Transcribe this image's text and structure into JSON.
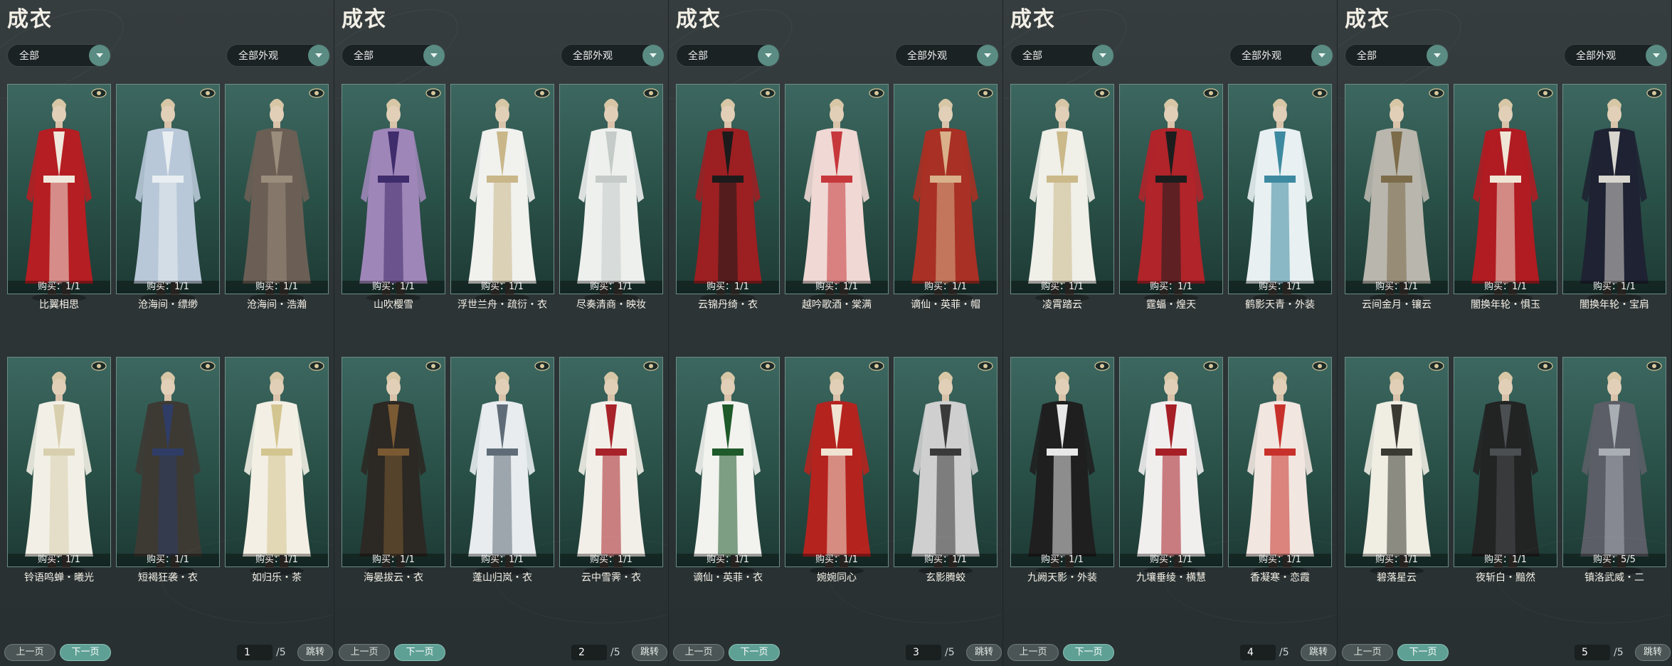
{
  "panels": [
    {
      "title": "成衣",
      "filter_category": "全部",
      "filter_appearance": "全部外观",
      "items": [
        {
          "name": "比翼相思",
          "buy": "购买：1/1",
          "color": "#b51e22",
          "accent": "#f0e8dc"
        },
        {
          "name": "沧海间・缥缈",
          "buy": "购买：1/1",
          "color": "#b8c8d8",
          "accent": "#e9eef2"
        },
        {
          "name": "沧海间・浩瀚",
          "buy": "购买：1/1",
          "color": "#6b5f55",
          "accent": "#9a8d7c"
        },
        {
          "name": "铃语鸣蝉・曦光",
          "buy": "购买：1/1",
          "color": "#f2f0e6",
          "accent": "#d8cfae"
        },
        {
          "name": "短褐狂袭・衣",
          "buy": "购买：1/1",
          "color": "#3d3a34",
          "accent": "#2f3d66"
        },
        {
          "name": "如归乐・茶",
          "buy": "购买：1/1",
          "color": "#f3efe4",
          "accent": "#d3c58f"
        }
      ],
      "prev_label": "上一页",
      "next_label": "下一页",
      "page": "1",
      "total": "/5",
      "jump_label": "跳转"
    },
    {
      "title": "成衣",
      "filter_category": "全部",
      "filter_appearance": "全部外观",
      "items": [
        {
          "name": "山吹樱雪",
          "buy": "购买：1/1",
          "color": "#9f86b8",
          "accent": "#3f2c6c"
        },
        {
          "name": "浮世兰舟・疏衍・衣",
          "buy": "购买：1/1",
          "color": "#f1f1ee",
          "accent": "#c9b78a"
        },
        {
          "name": "尽奏清商・映妆",
          "buy": "购买：1/1",
          "color": "#eef0ee",
          "accent": "#c4cbc8"
        },
        {
          "name": "海晏拔云・衣",
          "buy": "购买：1/1",
          "color": "#2c2823",
          "accent": "#7a5a33"
        },
        {
          "name": "蓬山归岚・衣",
          "buy": "购买：1/1",
          "color": "#e8ecee",
          "accent": "#5f6c78"
        },
        {
          "name": "云中雪霁・衣",
          "buy": "购买：1/1",
          "color": "#f2efe8",
          "accent": "#a8222a"
        }
      ],
      "prev_label": "上一页",
      "next_label": "下一页",
      "page": "2",
      "total": "/5",
      "jump_label": "跳转"
    },
    {
      "title": "成衣",
      "filter_category": "全部",
      "filter_appearance": "全部外观",
      "items": [
        {
          "name": "云锦丹绮・衣",
          "buy": "购买：1/1",
          "color": "#9c1f22",
          "accent": "#1c1a1a"
        },
        {
          "name": "越吟歌酒・棠满",
          "buy": "购买：1/1",
          "color": "#f0d8d4",
          "accent": "#c6383c"
        },
        {
          "name": "谪仙・英菲・帽",
          "buy": "购买：1/1",
          "color": "#a83024",
          "accent": "#d9b08a"
        },
        {
          "name": "谪仙・英菲・衣",
          "buy": "购买：1/1",
          "color": "#f2f2ee",
          "accent": "#1e5a2a"
        },
        {
          "name": "婉婉同心",
          "buy": "购买：1/1",
          "color": "#b5231f",
          "accent": "#f0e3d2"
        },
        {
          "name": "玄影腾蛟",
          "buy": "购买：1/1",
          "color": "#cfcfcf",
          "accent": "#3a3a3a"
        }
      ],
      "prev_label": "上一页",
      "next_label": "下一页",
      "page": "3",
      "total": "/5",
      "jump_label": "跳转"
    },
    {
      "title": "成衣",
      "filter_category": "全部",
      "filter_appearance": "全部外观",
      "items": [
        {
          "name": "凌霄踏云",
          "buy": "购买：1/1",
          "color": "#f0efe8",
          "accent": "#cbb98a"
        },
        {
          "name": "霆蝠・煌天",
          "buy": "购买：1/1",
          "color": "#b0242a",
          "accent": "#1d1d1d"
        },
        {
          "name": "鹤影天青・外装",
          "buy": "购买：1/1",
          "color": "#e8f0f2",
          "accent": "#3d8aa0"
        },
        {
          "name": "九阙天影・外装",
          "buy": "购买：1/1",
          "color": "#1f1f1f",
          "accent": "#e8e8e8"
        },
        {
          "name": "九壤垂绫・横慧",
          "buy": "购买：1/1",
          "color": "#f1eeee",
          "accent": "#a61f26"
        },
        {
          "name": "香凝寒・恋霞",
          "buy": "购买：1/1",
          "color": "#f2e6e0",
          "accent": "#c8312b"
        }
      ],
      "prev_label": "上一页",
      "next_label": "下一页",
      "page": "4",
      "total": "/5",
      "jump_label": "跳转"
    },
    {
      "title": "成衣",
      "filter_category": "全部",
      "filter_appearance": "全部外观",
      "items": [
        {
          "name": "云间金月・镶云",
          "buy": "购买：1/1",
          "color": "#b9b6ad",
          "accent": "#7c6c4a"
        },
        {
          "name": "闇换年轮・惧玉",
          "buy": "购买：1/1",
          "color": "#b01c22",
          "accent": "#f0e6d6"
        },
        {
          "name": "闇换年轮・宝肩",
          "buy": "购买：1/1",
          "color": "#1e2232",
          "accent": "#d9d6cf"
        },
        {
          "name": "碧落星云",
          "buy": "购买：1/1",
          "color": "#f0ede3",
          "accent": "#3a3a33"
        },
        {
          "name": "夜斩白・黯然",
          "buy": "购买：1/1",
          "color": "#222323",
          "accent": "#4c4f52"
        },
        {
          "name": "镇洛武威・二",
          "buy": "购买：5/5",
          "color": "#5b5e66",
          "accent": "#a9adb4"
        }
      ],
      "prev_label": "上一页",
      "next_label": "下一页",
      "page": "5",
      "total": "/5",
      "jump_label": "跳转"
    }
  ]
}
